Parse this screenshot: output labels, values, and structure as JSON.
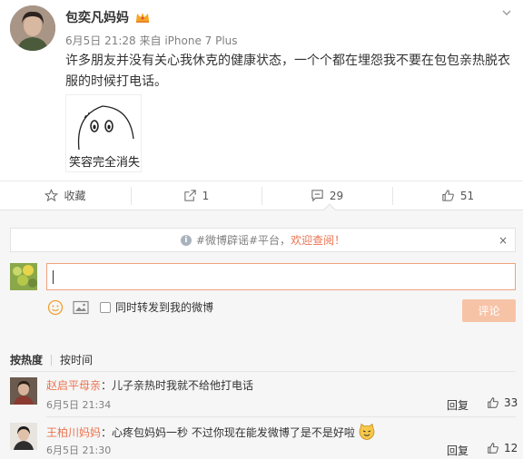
{
  "post": {
    "author": "包奕凡妈妈",
    "time": "6月5日 21:28",
    "source_prefix": "来自",
    "source": "iPhone 7 Plus",
    "text": "许多朋友并没有关心我休克的健康状态，一个个都在埋怨我不要在包包亲热脱衣服的时候打电话。",
    "meme_caption": "笑容完全消失"
  },
  "actions": {
    "favorite": {
      "label": "收藏",
      "icon": "star-icon"
    },
    "forward": {
      "label": "1",
      "icon": "share-icon"
    },
    "comment": {
      "label": "29",
      "icon": "comment-icon"
    },
    "like": {
      "label": "51",
      "icon": "thumbs-up-icon"
    }
  },
  "notice": {
    "tag": "#微博辟谣#",
    "text": "平台，",
    "link": "欢迎查阅！",
    "close": "×"
  },
  "composer": {
    "forward_label": "同时转发到我的微博",
    "submit_label": "评论"
  },
  "sort": {
    "active": "按热度",
    "other": "按时间"
  },
  "comments": [
    {
      "user": "赵启平母亲",
      "text": "：儿子亲热时我就不给他打电话",
      "time": "6月5日 21:34",
      "reply": "回复",
      "likes": "33"
    },
    {
      "user": "王柏川妈妈",
      "text": "：心疼包妈妈一秒 不过你现在能发微博了是不是好啦",
      "time": "6月5日 21:30",
      "reply": "回复",
      "likes": "12"
    }
  ],
  "colors": {
    "accent": "#eb7350",
    "submit_disabled": "#f7c3a7",
    "meta": "#808080",
    "comment_bg": "#f6f6f6"
  }
}
